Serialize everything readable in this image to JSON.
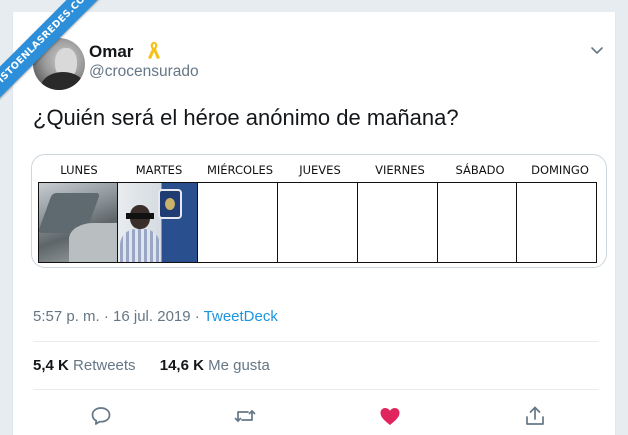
{
  "watermark": "VISTOENLASREDES.COM",
  "user": {
    "name": "Omar",
    "handle": "@crocensurado"
  },
  "tweet": {
    "text": "¿Quién será el héroe anónimo de mañana?"
  },
  "media": {
    "days": [
      "LUNES",
      "MARTES",
      "MIÉRCOLES",
      "JUEVES",
      "VIERNES",
      "SÁBADO",
      "DOMINGO"
    ]
  },
  "meta": {
    "datetime": "5:57 p. m. · 16 jul. 2019 · ",
    "source": "TweetDeck"
  },
  "stats": {
    "retweets_count": "5,4 K",
    "retweets_label": "Retweets",
    "likes_count": "14,6 K",
    "likes_label": "Me gusta"
  },
  "colors": {
    "like": "#e0245e",
    "link": "#1b95e0",
    "muted": "#657786",
    "ribbon": "#2d8fd9",
    "awareness_ribbon": "#f5c21b"
  },
  "icons": [
    "reply-icon",
    "retweet-icon",
    "like-icon",
    "share-icon",
    "chevron-down-icon",
    "awareness-ribbon-icon"
  ]
}
